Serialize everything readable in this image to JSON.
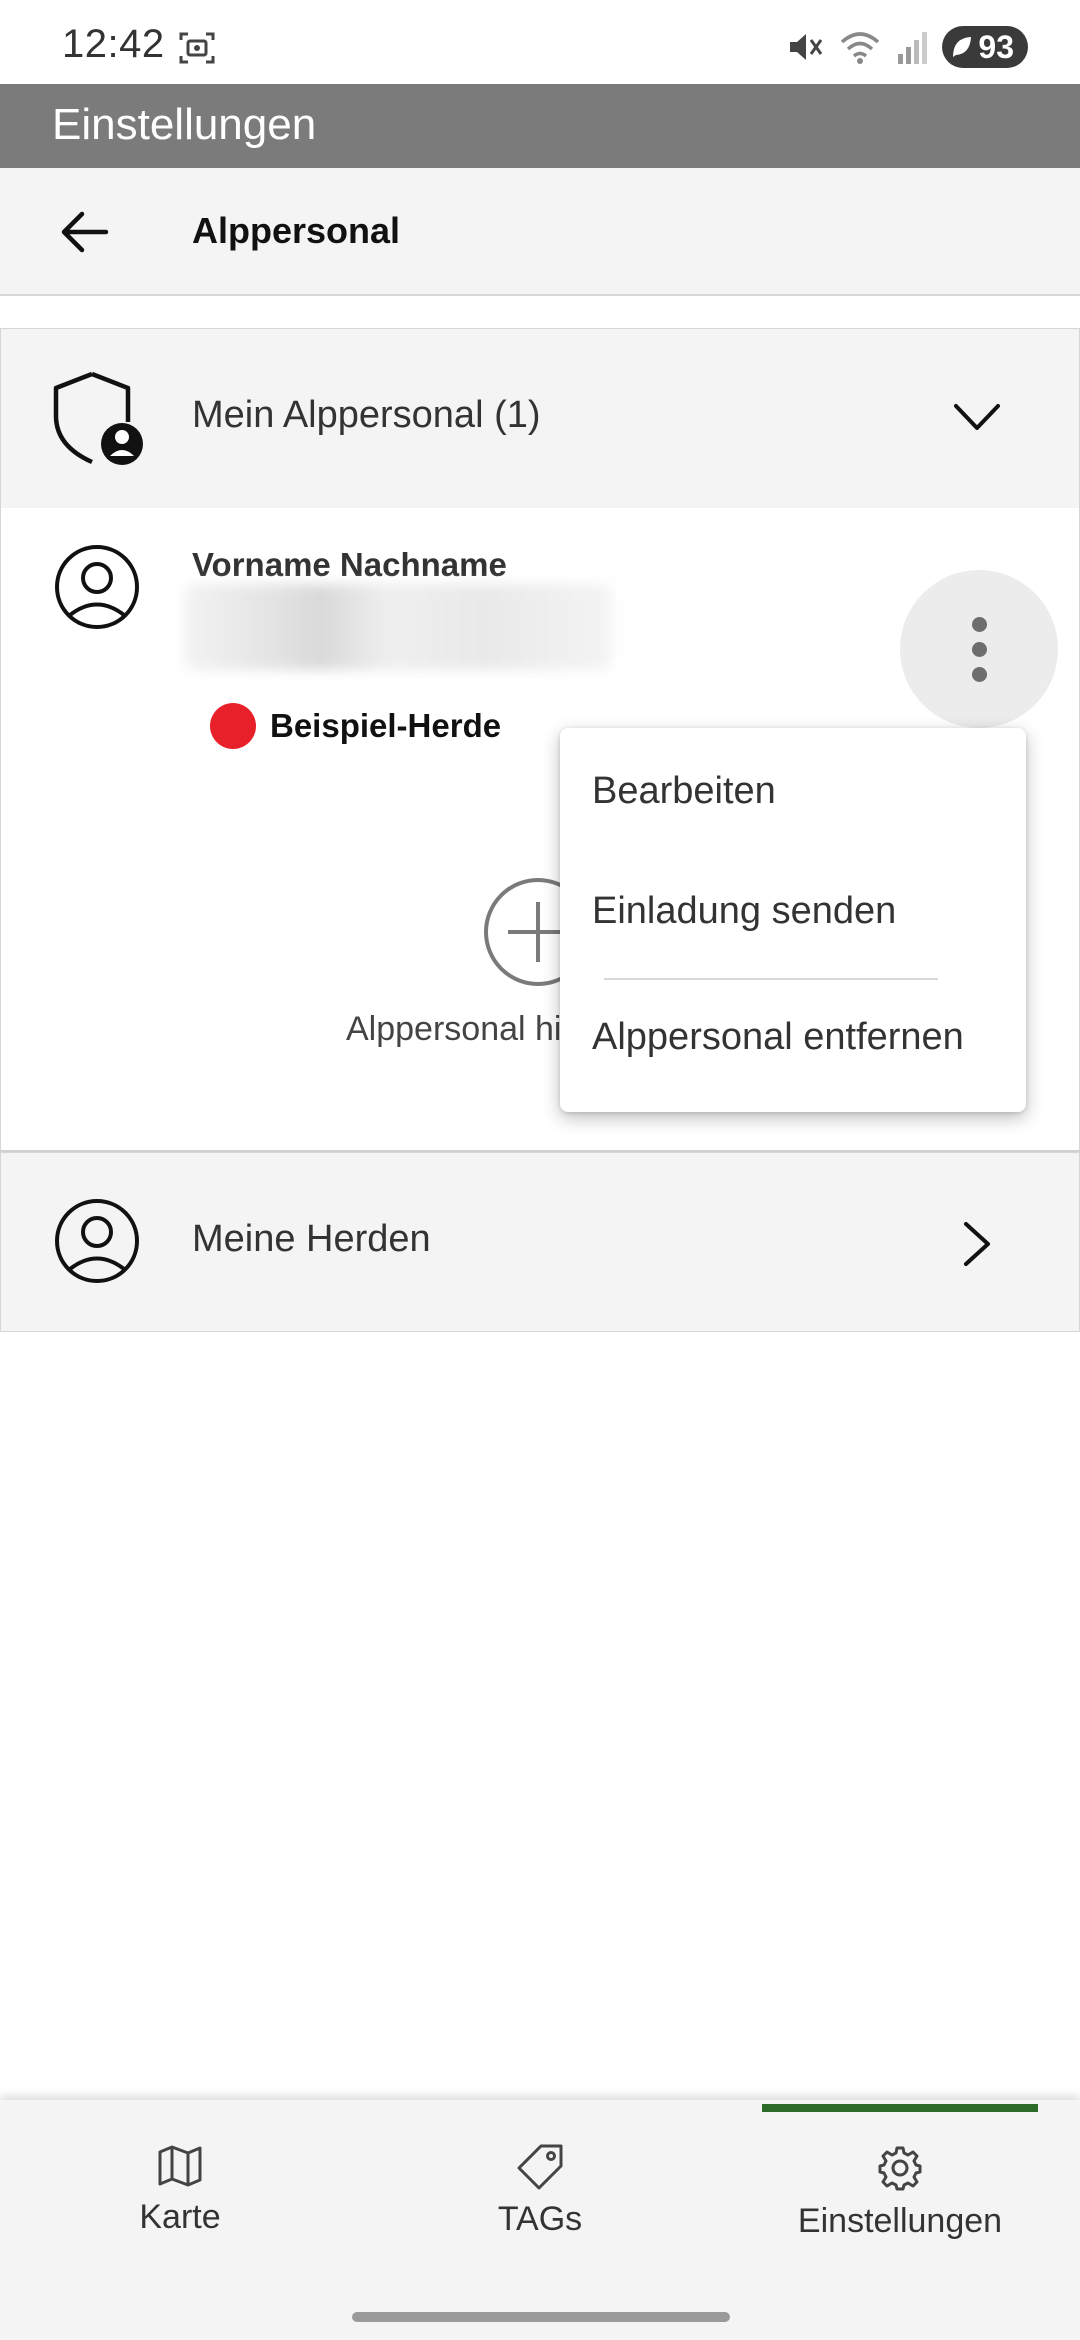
{
  "status_bar": {
    "time": "12:42",
    "battery": "93",
    "icons": [
      "screenshot-icon",
      "mute-icon",
      "wifi-icon",
      "signal-icon",
      "battery-icon"
    ]
  },
  "app_bar": {
    "title": "Einstellungen"
  },
  "sub_header": {
    "title": "Alppersonal",
    "back_icon": "arrow-left-icon"
  },
  "section_personal": {
    "label": "Mein Alppersonal (1)",
    "icon": "shield-user-icon",
    "expanded": true
  },
  "person": {
    "name": "Vorname Nachname",
    "herd": "Beispiel-Herde",
    "herd_color": "#e8202a"
  },
  "add_personal": {
    "label": "Alppersonal hinzufügen"
  },
  "section_herds": {
    "label": "Meine Herden",
    "icon": "user-circle-icon"
  },
  "context_menu": {
    "items": [
      "Bearbeiten",
      "Einladung senden",
      "Alppersonal entfernen"
    ]
  },
  "bottom_nav": {
    "items": [
      {
        "label": "Karte",
        "icon": "map-icon"
      },
      {
        "label": "TAGs",
        "icon": "tag-icon"
      },
      {
        "label": "Einstellungen",
        "icon": "gear-icon"
      }
    ],
    "active": "Einstellungen",
    "accent_color": "#2d6b2a"
  }
}
